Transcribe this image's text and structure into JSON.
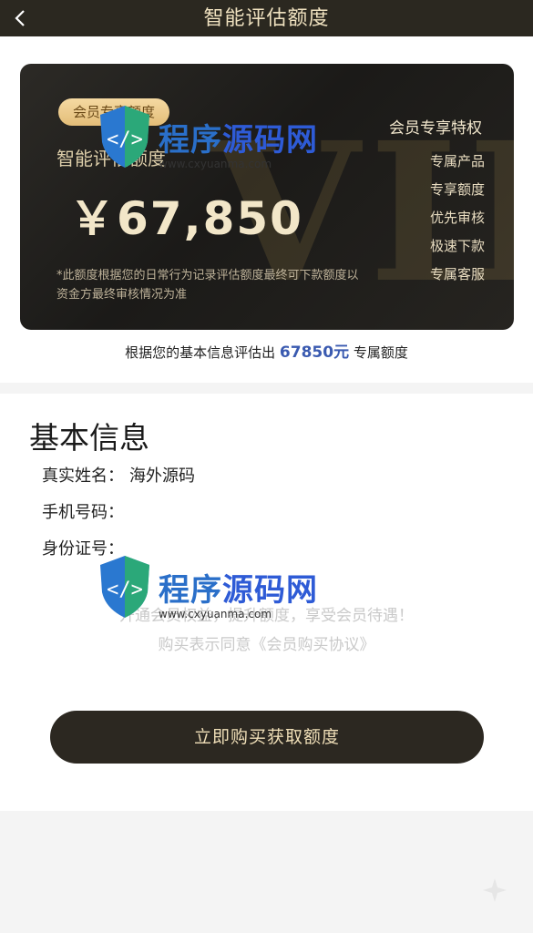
{
  "nav": {
    "title": "智能评估额度"
  },
  "card": {
    "badge": "会员专享额度",
    "label": "智能评估额度",
    "amount": "￥67,850",
    "note": "*此额度根据您的日常行为记录评估额度最终可下款额度以资金方最终审核情况为准",
    "watermark": "VIP",
    "privileges_title": "会员专享特权",
    "privileges": [
      "专属产品",
      "专享额度",
      "优先审核",
      "极速下款",
      "专属客服"
    ]
  },
  "evaluation": {
    "prefix": "根据您的基本信息评估出",
    "amount": "67850元",
    "suffix": "专属额度"
  },
  "info": {
    "title": "基本信息",
    "name_label": "真实姓名：",
    "name_value": "海外源码",
    "phone_label": "手机号码：",
    "id_label": "身份证号："
  },
  "agreement": {
    "line1": "开通会员权益，提升额度，享受会员待遇！",
    "line2": "购买表示同意《会员购买协议》"
  },
  "buy_button": "立即购买获取额度",
  "watermark_logo": {
    "text_part1": "程序",
    "text_part2": "源码网",
    "url": "www.cxyuanma.com"
  },
  "colors": {
    "nav_bg": "#2b2820",
    "gold": "#f0dfb8",
    "accent_blue": "#3a5ab0"
  },
  "icons": {
    "back": "chevron-left-icon",
    "sparkle": "sparkle-icon"
  }
}
